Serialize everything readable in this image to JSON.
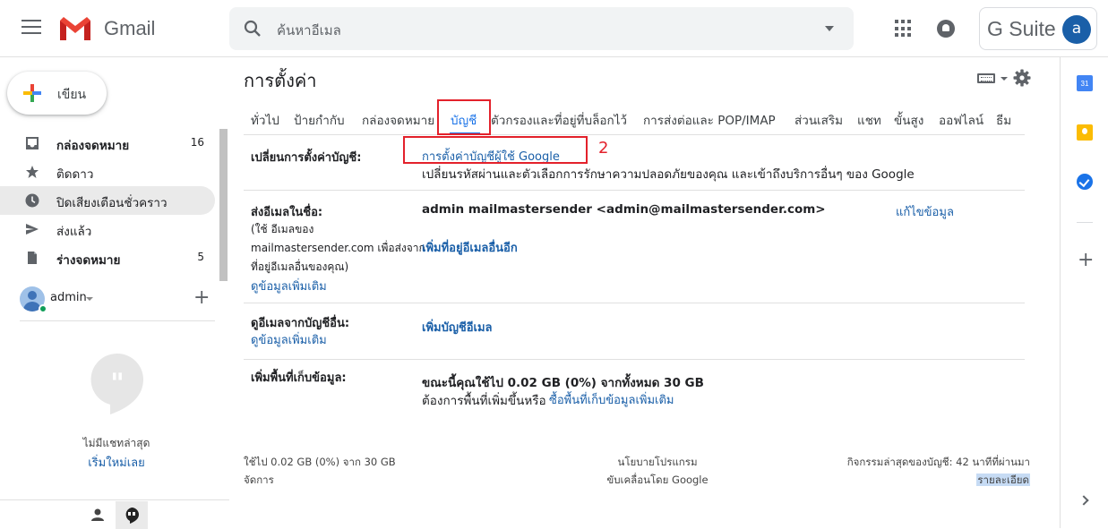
{
  "header": {
    "app_name": "Gmail",
    "search_placeholder": "ค้นหาอีเมล",
    "gsuite_label": "G Suite",
    "account_initial": "a"
  },
  "sidebar": {
    "compose_label": "เขียน",
    "items": [
      {
        "label": "กล่องจดหมาย",
        "count": "16",
        "icon": "inbox-icon",
        "bold": true
      },
      {
        "label": "ติดดาว",
        "count": "",
        "icon": "star-icon",
        "bold": false
      },
      {
        "label": "ปิดเสียงเตือนชั่วคราว",
        "count": "",
        "icon": "clock-icon",
        "bold": false
      },
      {
        "label": "ส่งแล้ว",
        "count": "",
        "icon": "send-icon",
        "bold": false
      },
      {
        "label": "ร่างจดหมาย",
        "count": "5",
        "icon": "draft-icon",
        "bold": true
      }
    ],
    "hangouts_user": "admin",
    "no_chats": "ไม่มีแชทล่าสุด",
    "start_new": "เริ่มใหม่เลย"
  },
  "settings": {
    "title": "การตั้งค่า",
    "tabs": [
      "ทั่วไป",
      "ป้ายกำกับ",
      "กล่องจดหมาย",
      "บัญชี",
      "ตัวกรองและที่อยู่ที่บล็อกไว้",
      "การส่งต่อและ POP/IMAP",
      "ส่วนเสริม",
      "แชท",
      "ขั้นสูง",
      "ออฟไลน์",
      "ธีม"
    ],
    "active_tab": "บัญชี",
    "annotation_number": "2",
    "change_account": {
      "label": "เปลี่ยนการตั้งค่าบัญชี:",
      "link": "การตั้งค่าบัญชีผู้ใช้ Google",
      "desc": "เปลี่ยนรหัสผ่านและตัวเลือกการรักษาความปลอดภัยของคุณ และเข้าถึงบริการอื่นๆ ของ Google"
    },
    "send_as": {
      "label": "ส่งอีเมลในชื่อ:",
      "sub1": "(ใช้ อีเมลของ",
      "sub2": "mailmastersender.com เพื่อส่งจาก",
      "sub3": "ที่อยู่อีเมลอื่นของคุณ)",
      "learn_more": "ดูข้อมูลเพิ่มเติม",
      "address": "admin mailmastersender <admin@mailmastersender.com>",
      "edit": "แก้ไขข้อมูล",
      "add_other": "เพิ่มที่อยู่อีเมลอื่นอีก"
    },
    "check_mail": {
      "label": "ดูอีเมลจากบัญชีอื่น:",
      "learn_more": "ดูข้อมูลเพิ่มเติม",
      "add_account": "เพิ่มบัญชีอีเมล"
    },
    "storage": {
      "label": "เพิ่มพื้นที่เก็บข้อมูล:",
      "usage": "ขณะนี้คุณใช้ไป 0.02 GB (0%) จากทั้งหมด 30 GB",
      "need_more": "ต้องการพื้นที่เพิ่มขึ้นหรือ",
      "buy_link": "ซื้อพื้นที่เก็บข้อมูลเพิ่มเติม"
    }
  },
  "footer": {
    "usage": "ใช้ไป 0.02 GB (0%) จาก 30 GB",
    "manage": "จัดการ",
    "program_policy": "นโยบายโปรแกรม",
    "powered_by": "ขับเคลื่อนโดย Google",
    "last_activity": "กิจกรรมล่าสุดของบัญชี: 42 นาทีที่ผ่านมา",
    "details": "รายละเอียด"
  },
  "right_panel": {
    "calendar_day": "31"
  },
  "colors": {
    "accent": "#1a73e8",
    "link": "#1a5fa8",
    "annotation_red": "#e3212b"
  }
}
